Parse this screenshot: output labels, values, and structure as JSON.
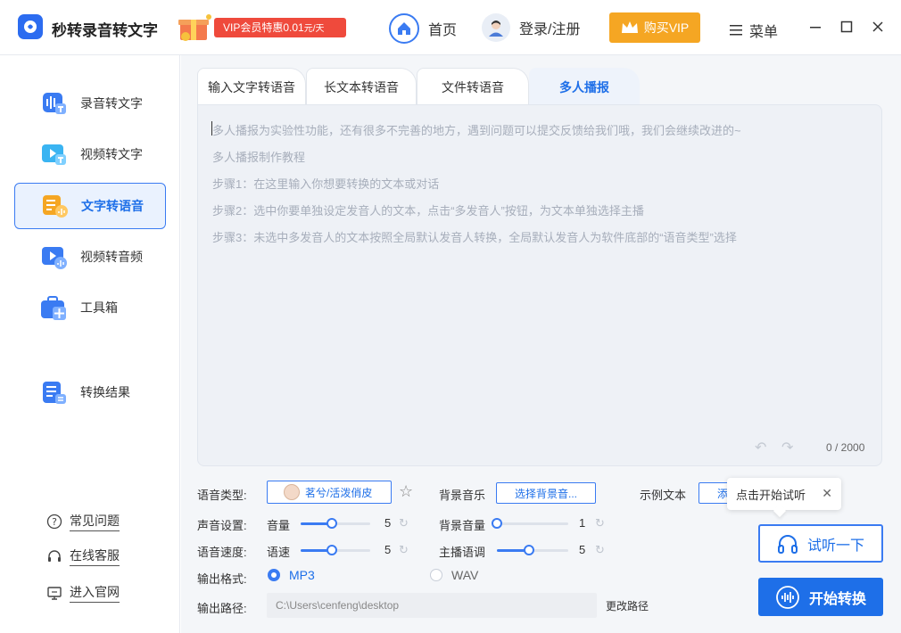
{
  "app": {
    "title": "秒转录音转文字"
  },
  "promo": {
    "text": "VIP会员特惠0.01",
    "unit": "元/天"
  },
  "nav": {
    "home": "首页",
    "login": "登录/注册",
    "vip": "购买VIP",
    "menu": "菜单"
  },
  "sidebar": {
    "items": [
      {
        "label": "录音转文字",
        "icon": "audio-to-text-icon"
      },
      {
        "label": "视频转文字",
        "icon": "video-to-text-icon"
      },
      {
        "label": "文字转语音",
        "icon": "text-to-speech-icon",
        "active": true
      },
      {
        "label": "视频转音频",
        "icon": "video-to-audio-icon"
      },
      {
        "label": "工具箱",
        "icon": "toolbox-icon"
      },
      {
        "label": "转换结果",
        "icon": "results-icon"
      }
    ],
    "footer": [
      {
        "label": "常见问题",
        "icon": "question-icon"
      },
      {
        "label": "在线客服",
        "icon": "headset-icon"
      },
      {
        "label": "进入官网",
        "icon": "monitor-icon"
      }
    ]
  },
  "tabs": [
    "输入文字转语音",
    "长文本转语音",
    "文件转语音",
    "多人播报"
  ],
  "editor": {
    "lines": [
      "多人播报为实验性功能，还有很多不完善的地方，遇到问题可以提交反馈给我们哦，我们会继续改进的~",
      "多人播报制作教程",
      "步骤1：在这里输入你想要转换的文本或对话",
      "步骤2：选中你要单独设定发音人的文本，点击“多发音人”按钮，为文本单独选择主播",
      "步骤3：未选中多发音人的文本按照全局默认发音人转换，全局默认发音人为软件底部的“语音类型”选择"
    ],
    "count": "0 / 2000"
  },
  "settings": {
    "voice_type_label": "语音类型:",
    "voice_name": "茗兮/活泼俏皮",
    "bgm_label": "背景音乐",
    "bgm_button": "选择背景音...",
    "sample_label": "示例文本",
    "sample_button": "添",
    "sound_label": "声音设置:",
    "volume_label": "音量",
    "volume": 5,
    "bg_volume_label": "背景音量",
    "bg_volume": 1,
    "speed_label": "语音速度:",
    "speed_sub": "语速",
    "speed": 5,
    "pitch_label": "主播语调",
    "pitch": 5,
    "format_label": "输出格式:",
    "format_options": [
      "MP3",
      "WAV"
    ],
    "format_selected": "MP3",
    "path_label": "输出路径:",
    "path_value": "C:\\Users\\cenfeng\\desktop",
    "path_change": "更改路径"
  },
  "tooltip": {
    "text": "点击开始试听"
  },
  "buttons": {
    "listen": "试听一下",
    "start": "开始转换"
  },
  "colors": {
    "accent": "#1e6fe8",
    "vip": "#f5a623",
    "promo": "#ef4a3c"
  }
}
